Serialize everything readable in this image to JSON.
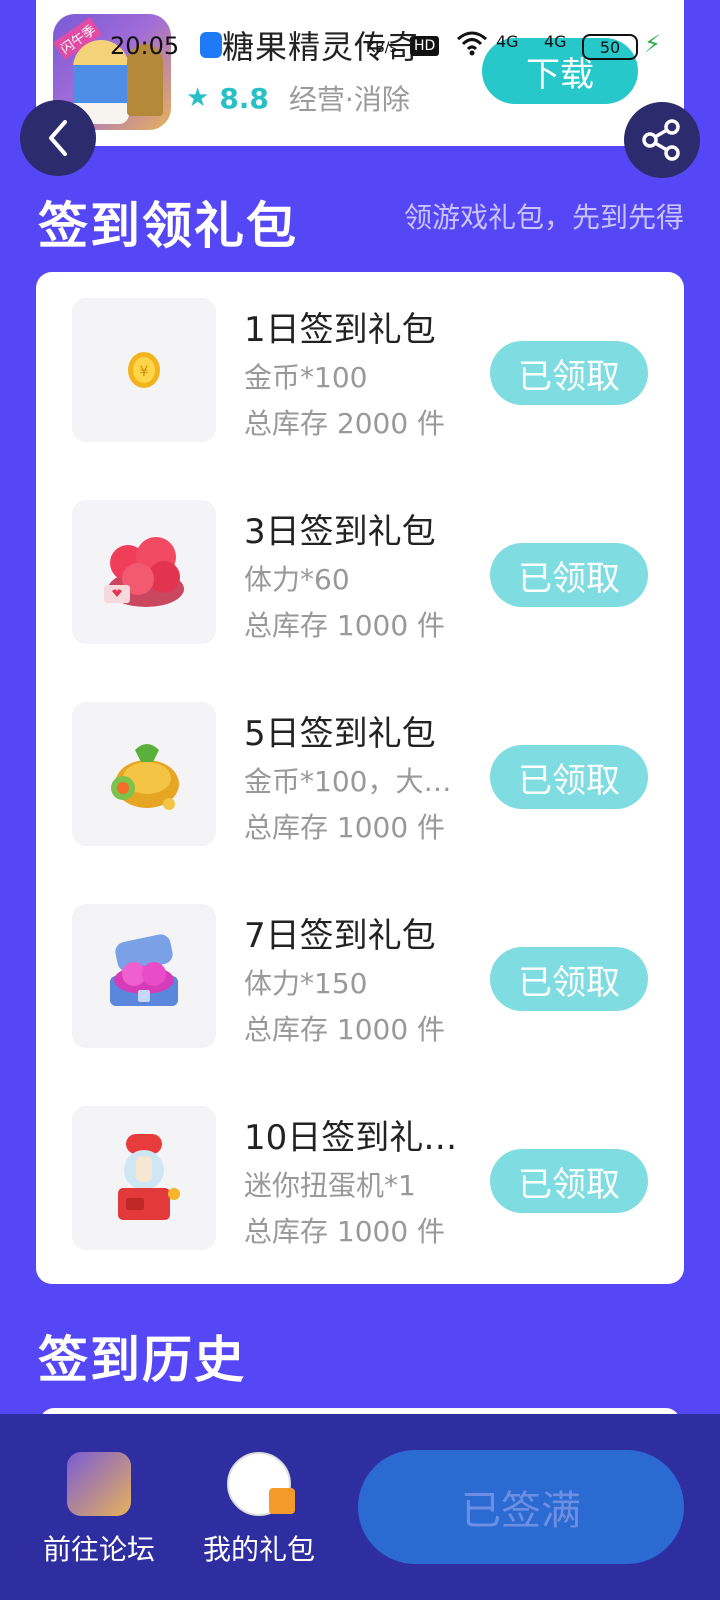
{
  "game": {
    "title": "糖果精灵传奇",
    "rating": "8.8",
    "genre": "经营·消除",
    "download_label": "下载",
    "icon_tag": "闪午季"
  },
  "status_bar": {
    "time": "20:05",
    "speed": "KB/s",
    "hd": "HD",
    "net1": "4G",
    "net2": "4G",
    "battery": "50"
  },
  "checkin": {
    "title": "签到领礼包",
    "subtitle": "领游戏礼包，先到先得",
    "gifts": [
      {
        "name": "1日签到礼包",
        "content": "金币*100",
        "stock": "总库存 2000 件",
        "button": "已领取",
        "icon": "coin-icon"
      },
      {
        "name": "3日签到礼包",
        "content": "体力*60",
        "stock": "总库存 1000 件",
        "button": "已领取",
        "icon": "hearts-icon"
      },
      {
        "name": "5日签到礼包",
        "content": "金币*100，大…",
        "stock": "总库存 1000 件",
        "button": "已领取",
        "icon": "money-bag-icon"
      },
      {
        "name": "7日签到礼包",
        "content": "体力*150",
        "stock": "总库存 1000 件",
        "button": "已领取",
        "icon": "heart-chest-icon"
      },
      {
        "name": "10日签到礼…",
        "content": "迷你扭蛋机*1",
        "stock": "总库存 1000 件",
        "button": "已领取",
        "icon": "gacha-machine-icon"
      }
    ]
  },
  "history": {
    "title": "签到历史"
  },
  "bottom_bar": {
    "forum_label": "前往论坛",
    "my_gifts_label": "我的礼包",
    "signed_label": "已签满"
  },
  "colors": {
    "background": "#5547f5",
    "accent": "#27c8c9",
    "claimed": "#7fdde1",
    "bottom_bar": "#2f2ea0",
    "signed_button": "#2b6ad0"
  }
}
